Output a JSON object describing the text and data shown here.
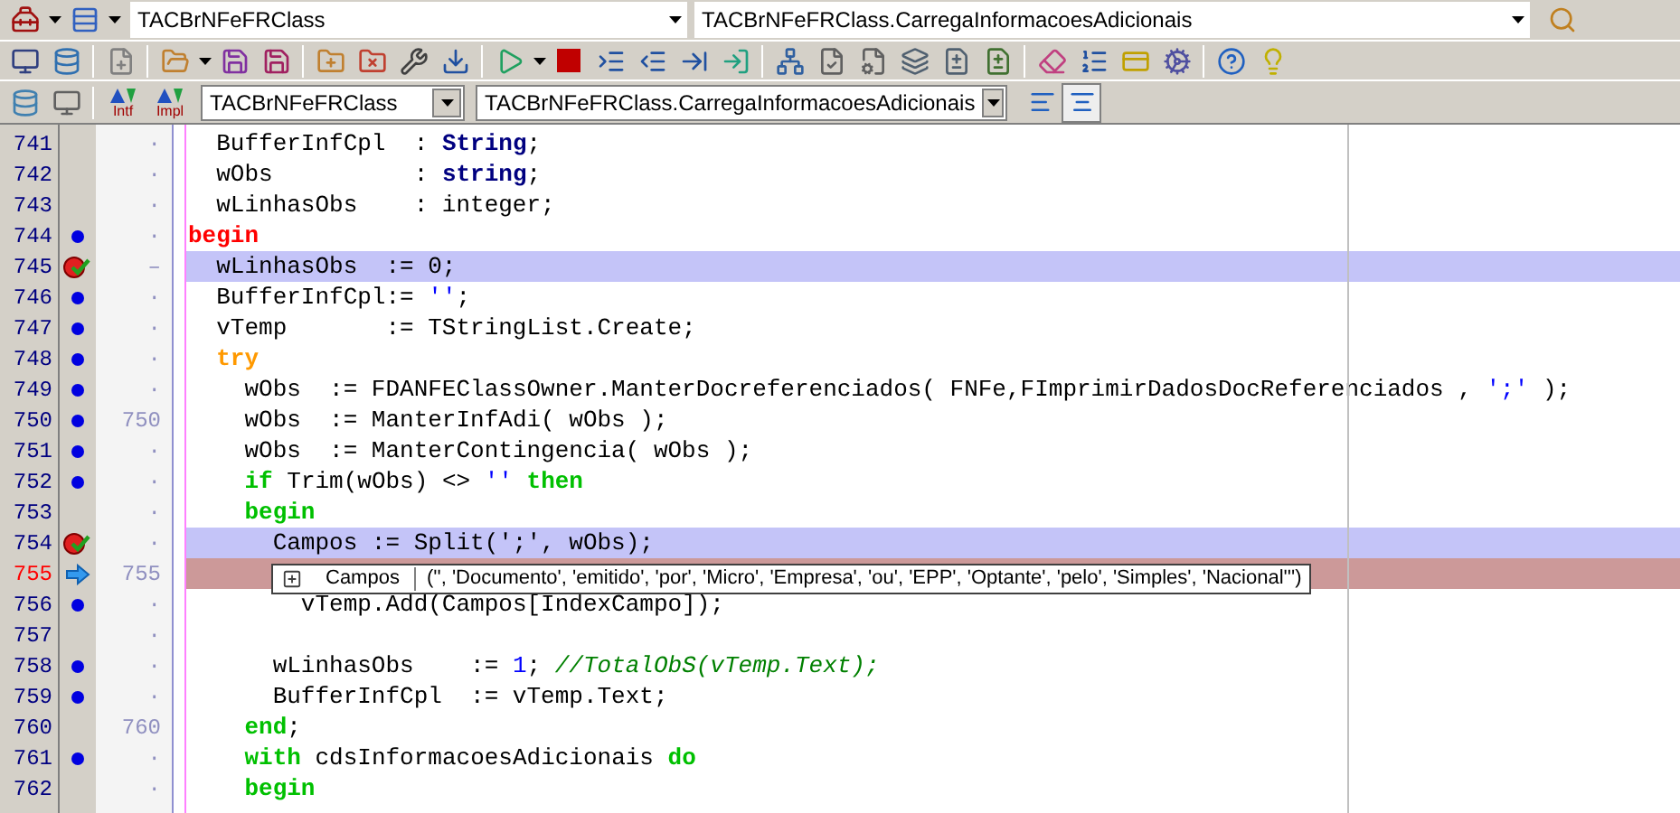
{
  "toolbar_top": {
    "class_combo": {
      "value": "TACBrNFeFRClass"
    },
    "method_combo": {
      "value": "TACBrNFeFRClass.CarregaInformacoesAdicionais"
    }
  },
  "navigation_bar": {
    "buttons": [
      {
        "label": "Intf"
      },
      {
        "label": "Impl"
      }
    ],
    "class_combo": {
      "value": "TACBrNFeFRClass"
    },
    "method_combo": {
      "value": "TACBrNFeFRClass.CarregaInformacoesAdicionais"
    },
    "view_buttons": [
      {
        "selected": false
      },
      {
        "selected": true
      }
    ]
  },
  "editor": {
    "lines": [
      {
        "number": "741",
        "executable": false,
        "breakpoint": false,
        "current": false,
        "column_3": "·",
        "code": [
          {
            "kind": "text",
            "text": "  BufferInfCpl  : "
          },
          {
            "kind": "type",
            "text": "String"
          },
          {
            "kind": "text",
            "text": ";"
          }
        ]
      },
      {
        "number": "742",
        "executable": false,
        "breakpoint": false,
        "current": false,
        "column_3": "·",
        "code": [
          {
            "kind": "text",
            "text": "  wObs          : "
          },
          {
            "kind": "type",
            "text": "string"
          },
          {
            "kind": "text",
            "text": ";"
          }
        ]
      },
      {
        "number": "743",
        "executable": false,
        "breakpoint": false,
        "current": false,
        "column_3": "·",
        "code": [
          {
            "kind": "text",
            "text": "  wLinhasObs    : integer;"
          }
        ]
      },
      {
        "number": "744",
        "executable": true,
        "breakpoint": false,
        "current": false,
        "column_3": "·",
        "code": [
          {
            "kind": "keyword",
            "color": "#ff0000",
            "text": "begin"
          }
        ]
      },
      {
        "number": "745",
        "executable": false,
        "breakpoint": true,
        "current": false,
        "column_3": "–",
        "code": [
          {
            "kind": "text",
            "text": "  wLinhasObs  := 0;"
          }
        ]
      },
      {
        "number": "746",
        "executable": true,
        "breakpoint": false,
        "current": false,
        "column_3": "·",
        "code": [
          {
            "kind": "text",
            "text": "  BufferInfCpl:= "
          },
          {
            "kind": "string",
            "text": "''"
          },
          {
            "kind": "text",
            "text": ";"
          }
        ]
      },
      {
        "number": "747",
        "executable": true,
        "breakpoint": false,
        "current": false,
        "column_3": "·",
        "code": [
          {
            "kind": "text",
            "text": "  vTemp       := TStringList.Create;"
          }
        ]
      },
      {
        "number": "748",
        "executable": true,
        "breakpoint": false,
        "current": false,
        "column_3": "·",
        "code": [
          {
            "kind": "keyword",
            "color": "#ff9900",
            "text": "  try"
          }
        ]
      },
      {
        "number": "749",
        "executable": true,
        "breakpoint": false,
        "current": false,
        "column_3": "·",
        "code": [
          {
            "kind": "text",
            "text": "    wObs  := FDANFEClassOwner.ManterDocreferenciados( FNFe,FImprimirDadosDocReferenciados , "
          },
          {
            "kind": "string",
            "text": "';'"
          },
          {
            "kind": "text",
            "text": " );"
          }
        ]
      },
      {
        "number": "750",
        "executable": true,
        "breakpoint": false,
        "current": false,
        "column_3": "750",
        "code": [
          {
            "kind": "text",
            "text": "    wObs  := ManterInfAdi( wObs );"
          }
        ]
      },
      {
        "number": "751",
        "executable": true,
        "breakpoint": false,
        "current": false,
        "column_3": "·",
        "code": [
          {
            "kind": "text",
            "text": "    wObs  := ManterContingencia( wObs );"
          }
        ]
      },
      {
        "number": "752",
        "executable": true,
        "breakpoint": false,
        "current": false,
        "column_3": "·",
        "code": [
          {
            "kind": "keyword",
            "color": "#00c000",
            "text": "    if"
          },
          {
            "kind": "text",
            "text": " Trim(wObs) <> "
          },
          {
            "kind": "string",
            "text": "''"
          },
          {
            "kind": "keyword",
            "color": "#00c000",
            "text": " then"
          }
        ]
      },
      {
        "number": "753",
        "executable": false,
        "breakpoint": false,
        "current": false,
        "column_3": "·",
        "code": [
          {
            "kind": "keyword",
            "color": "#00c000",
            "text": "    begin"
          }
        ]
      },
      {
        "number": "754",
        "executable": false,
        "breakpoint": true,
        "current": false,
        "column_3": "·",
        "code": [
          {
            "kind": "text",
            "text": "      Campos := Split(';', wObs);"
          }
        ]
      },
      {
        "number": "755",
        "executable": false,
        "breakpoint": false,
        "current": true,
        "column_3": "755"
      },
      {
        "number": "756",
        "executable": true,
        "breakpoint": false,
        "current": false,
        "column_3": "·",
        "code": [
          {
            "kind": "text",
            "text": "        vTemp.Add(Campos[IndexCampo]);"
          }
        ]
      },
      {
        "number": "757",
        "executable": false,
        "breakpoint": false,
        "current": false,
        "column_3": "·"
      },
      {
        "number": "758",
        "executable": true,
        "breakpoint": false,
        "current": false,
        "column_3": "·",
        "code": [
          {
            "kind": "text",
            "text": "      wLinhasObs    := "
          },
          {
            "kind": "number",
            "text": "1"
          },
          {
            "kind": "text",
            "text": "; "
          },
          {
            "kind": "comment",
            "text": "//TotalObS(vTemp.Text);"
          }
        ]
      },
      {
        "number": "759",
        "executable": true,
        "breakpoint": false,
        "current": false,
        "column_3": "·",
        "code": [
          {
            "kind": "text",
            "text": "      BufferInfCpl  := vTemp.Text;"
          }
        ]
      },
      {
        "number": "760",
        "executable": false,
        "breakpoint": false,
        "current": false,
        "column_3": "760",
        "code": [
          {
            "kind": "keyword",
            "color": "#00c000",
            "text": "    end"
          },
          {
            "kind": "text",
            "text": ";"
          }
        ]
      },
      {
        "number": "761",
        "executable": true,
        "breakpoint": false,
        "current": false,
        "column_3": "·",
        "code": [
          {
            "kind": "keyword",
            "color": "#00c000",
            "text": "    with"
          },
          {
            "kind": "text",
            "text": " cdsInformacoesAdicionais "
          },
          {
            "kind": "keyword",
            "color": "#00c000",
            "text": "do"
          }
        ]
      },
      {
        "number": "762",
        "executable": false,
        "breakpoint": false,
        "current": false,
        "column_3": "·",
        "code": [
          {
            "kind": "keyword",
            "color": "#00c000",
            "text": "    begin"
          }
        ]
      }
    ]
  },
  "evaluation_tooltip": {
    "name": "Campos",
    "value": "('', 'Documento', 'emitido', 'por', 'Micro', 'Empresa', 'ou', 'EPP', 'Optante', 'pelo', 'Simples', 'Nacional''')"
  }
}
